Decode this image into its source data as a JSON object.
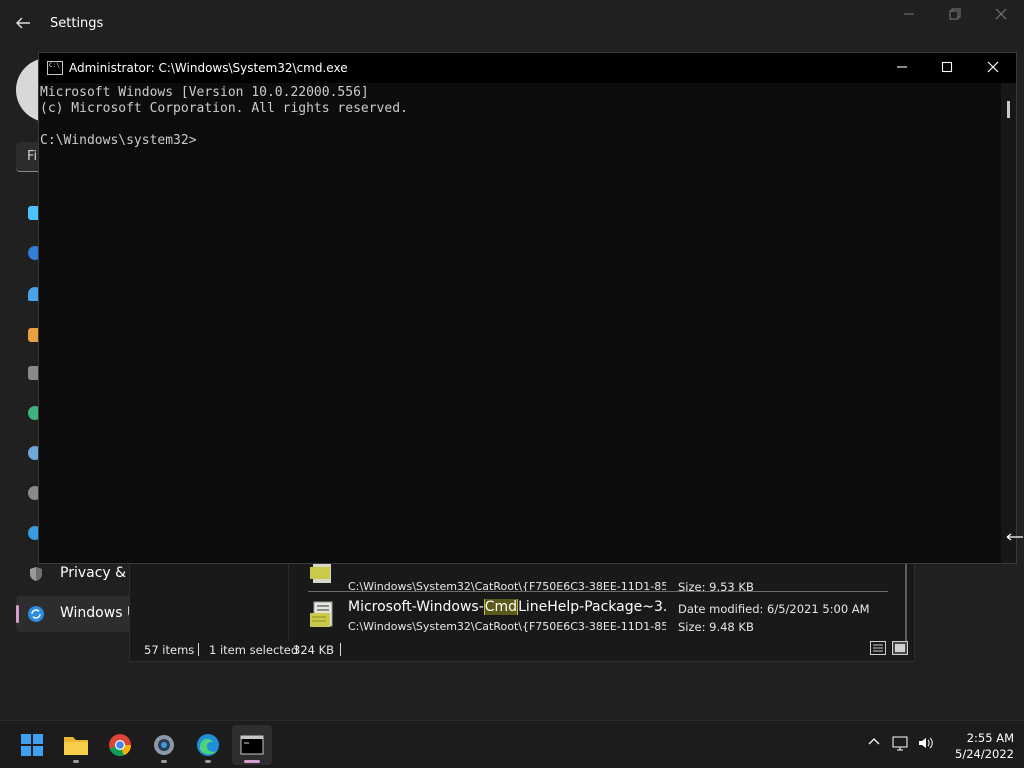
{
  "settings": {
    "title": "Settings",
    "back_icon": "back-arrow-icon",
    "find_placeholder": "Fi",
    "nav_items": [
      {
        "label": "Privacy & s",
        "icon": "shield-icon"
      },
      {
        "label": "Windows U",
        "icon": "windows-update-icon"
      }
    ]
  },
  "search": {
    "results": [
      {
        "name": "",
        "path": "C:\\Windows\\System32\\CatRoot\\{F750E6C3-38EE-11D1-85...",
        "date": "",
        "size": "Size: 9.53 KB"
      },
      {
        "name_prefix": "Microsoft-Windows-",
        "name_highlight": "Cmd",
        "name_suffix": "LineHelp-Package~3...",
        "path": "C:\\Windows\\System32\\CatRoot\\{F750E6C3-38EE-11D1-85...",
        "date": "Date modified: 6/5/2021 5:00 AM",
        "size": "Size: 9.48 KB"
      }
    ],
    "status": {
      "items": "57 items",
      "selected": "1 item selected",
      "size": "324 KB"
    }
  },
  "cmd": {
    "title": "Administrator: C:\\Windows\\System32\\cmd.exe",
    "lines": [
      "Microsoft Windows [Version 10.0.22000.556]",
      "(c) Microsoft Corporation. All rights reserved.",
      "",
      "C:\\Windows\\system32>"
    ]
  },
  "taskbar": {
    "apps": [
      {
        "name": "start",
        "icon": "windows-start-icon"
      },
      {
        "name": "file-explorer",
        "icon": "folder-icon"
      },
      {
        "name": "chrome",
        "icon": "chrome-icon"
      },
      {
        "name": "settings",
        "icon": "gear-icon"
      },
      {
        "name": "edge",
        "icon": "edge-icon"
      },
      {
        "name": "cmd",
        "icon": "terminal-icon"
      }
    ],
    "time": "2:55 AM",
    "date": "5/24/2022"
  },
  "colors": {
    "accent": "#d69fcb",
    "highlight_bg": "#5a5a1c",
    "console_bg": "#0c0c0c",
    "console_fg": "#cccccc"
  }
}
